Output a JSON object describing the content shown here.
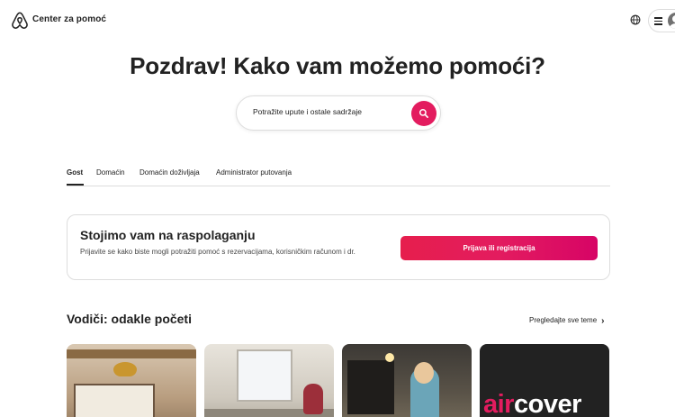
{
  "header": {
    "brand": "Center za pomoć",
    "logo_icon": "airbnb-logo-icon",
    "language_icon": "globe-icon",
    "menu_icon": "hamburger-menu-icon",
    "profile_icon": "user-avatar-icon"
  },
  "hero": {
    "title": "Pozdrav! Kako vam možemo pomoći?",
    "search_placeholder": "Potražite upute i ostale sadržaje",
    "search_icon": "search-icon"
  },
  "tabs": [
    {
      "label": "Gost",
      "active": true
    },
    {
      "label": "Domaćin",
      "active": false
    },
    {
      "label": "Domaćin doživljaja",
      "active": false
    },
    {
      "label": "Administrator putovanja",
      "active": false
    }
  ],
  "login_card": {
    "title": "Stojimo vam na raspolaganju",
    "text": "Prijavite se kako biste mogli potražiti pomoć s rezervacijama, korisničkim računom i dr.",
    "button_label": "Prijava ili registracija"
  },
  "guides": {
    "title": "Vodiči: odakle početi",
    "see_all": "Pregledajte sve teme",
    "see_all_icon": "chevron-right-icon",
    "aircover_text_1": "air",
    "aircover_text_2": "cover"
  },
  "colors": {
    "brand": "#e31c5f",
    "text": "#222222",
    "border": "#dddddd"
  }
}
